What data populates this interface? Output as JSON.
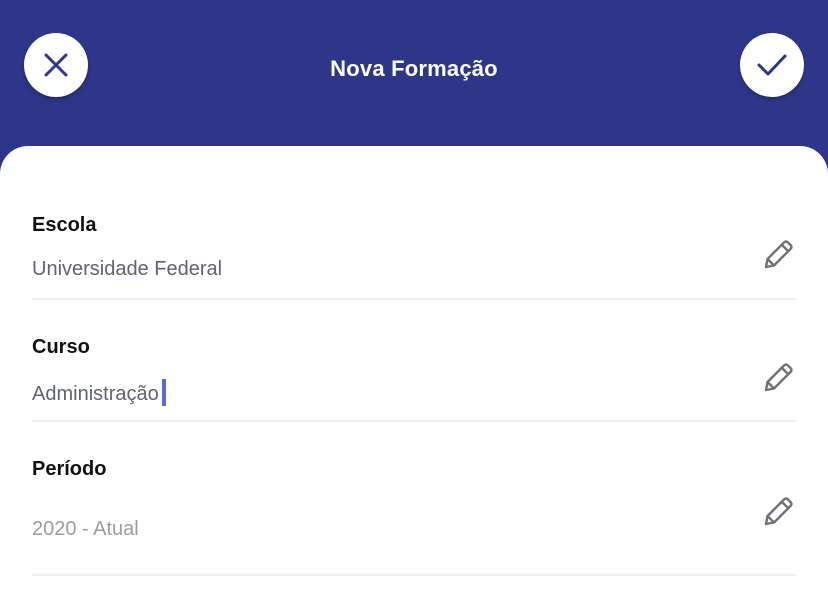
{
  "header": {
    "title": "Nova Formação",
    "close_icon": "close-icon",
    "confirm_icon": "check-icon",
    "background_color": "#2e368a"
  },
  "form": {
    "fields": [
      {
        "label": "Escola",
        "value": "Universidade Federal",
        "icon": "pencil-icon"
      },
      {
        "label": "Curso",
        "value": "Administração",
        "icon": "pencil-icon",
        "focused": true
      },
      {
        "label": "Período",
        "value": "2020 - Atual",
        "icon": "pencil-icon"
      }
    ]
  }
}
